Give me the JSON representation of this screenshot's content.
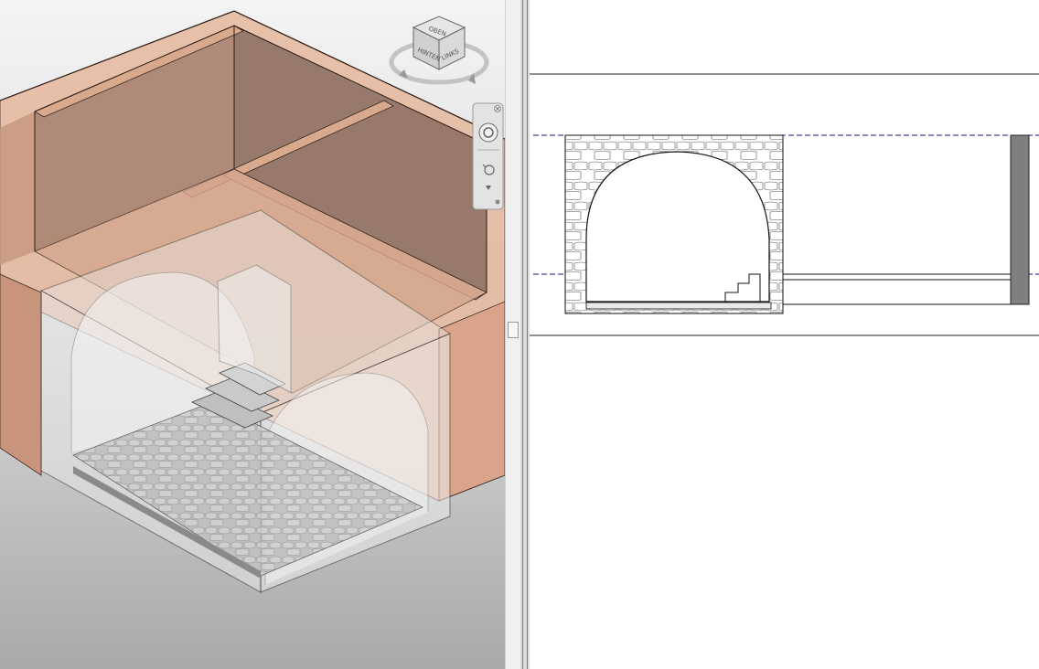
{
  "viewcube": {
    "faces": [
      "HINTEN",
      "LINKS",
      "OBEN"
    ]
  },
  "navigation_bar": {
    "icons": [
      "close-icon",
      "steering-wheel-icon",
      "zoom-icon",
      "dropdown-arrow-icon",
      "customize-icon"
    ]
  },
  "colors": {
    "wall": "#e5b9a0",
    "wall_dark": "#9a7a6c",
    "glass": "#d8d8d8",
    "ground_top": "#f2f2f2",
    "ground_bottom": "#a9a9a9",
    "level_line": "#1a1a8a"
  }
}
